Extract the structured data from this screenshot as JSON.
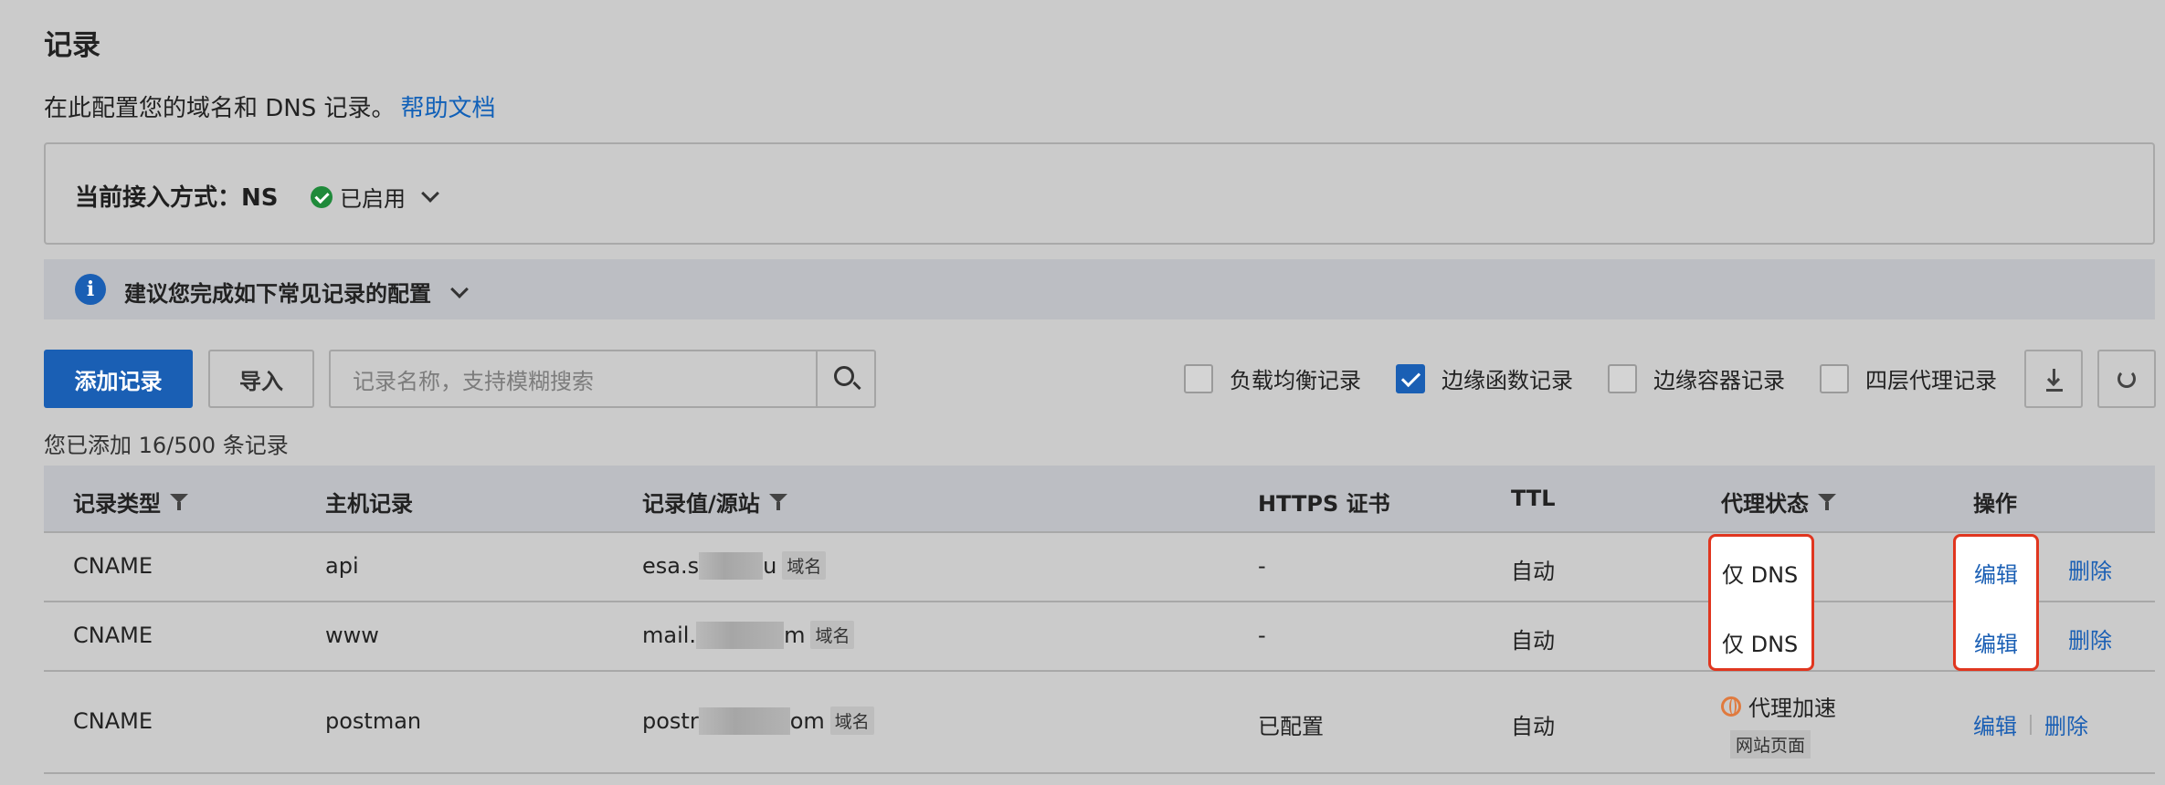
{
  "header": {
    "title": "记录",
    "description": "在此配置您的域名和 DNS 记录。",
    "help_link": "帮助文档"
  },
  "access": {
    "label": "当前接入方式：NS",
    "status": "已启用"
  },
  "tip": {
    "text": "建议您完成如下常见记录的配置"
  },
  "toolbar": {
    "add_label": "添加记录",
    "import_label": "导入",
    "search_placeholder": "记录名称，支持模糊搜索",
    "filters": [
      {
        "label": "负载均衡记录",
        "checked": false
      },
      {
        "label": "边缘函数记录",
        "checked": true
      },
      {
        "label": "边缘容器记录",
        "checked": false
      },
      {
        "label": "四层代理记录",
        "checked": false
      }
    ]
  },
  "count_text": "您已添加 16/500 条记录",
  "table": {
    "headers": [
      "记录类型",
      "主机记录",
      "记录值/源站",
      "HTTPS 证书",
      "TTL",
      "代理状态",
      "操作"
    ],
    "rows": [
      {
        "type": "CNAME",
        "host": "api",
        "value_prefix": "esa.s",
        "value_suffix": "u",
        "value_tag": "域名",
        "https": "-",
        "ttl": "自动",
        "proxy": "仅 DNS",
        "proxy_sub": "",
        "edit": "编辑",
        "delete": "删除"
      },
      {
        "type": "CNAME",
        "host": "www",
        "value_prefix": "mail.",
        "value_suffix": "m",
        "value_tag": "域名",
        "https": "-",
        "ttl": "自动",
        "proxy": "仅 DNS",
        "proxy_sub": "",
        "edit": "编辑",
        "delete": "删除"
      },
      {
        "type": "CNAME",
        "host": "postman",
        "value_prefix": "postr",
        "value_suffix": "om",
        "value_tag": "域名",
        "https": "已配置",
        "ttl": "自动",
        "proxy": "代理加速",
        "proxy_sub": "网站页面",
        "edit": "编辑",
        "delete": "删除"
      }
    ]
  },
  "colors": {
    "primary": "#1a5fb4",
    "highlight_border": "#e0361f",
    "success": "#1f8a3a"
  }
}
